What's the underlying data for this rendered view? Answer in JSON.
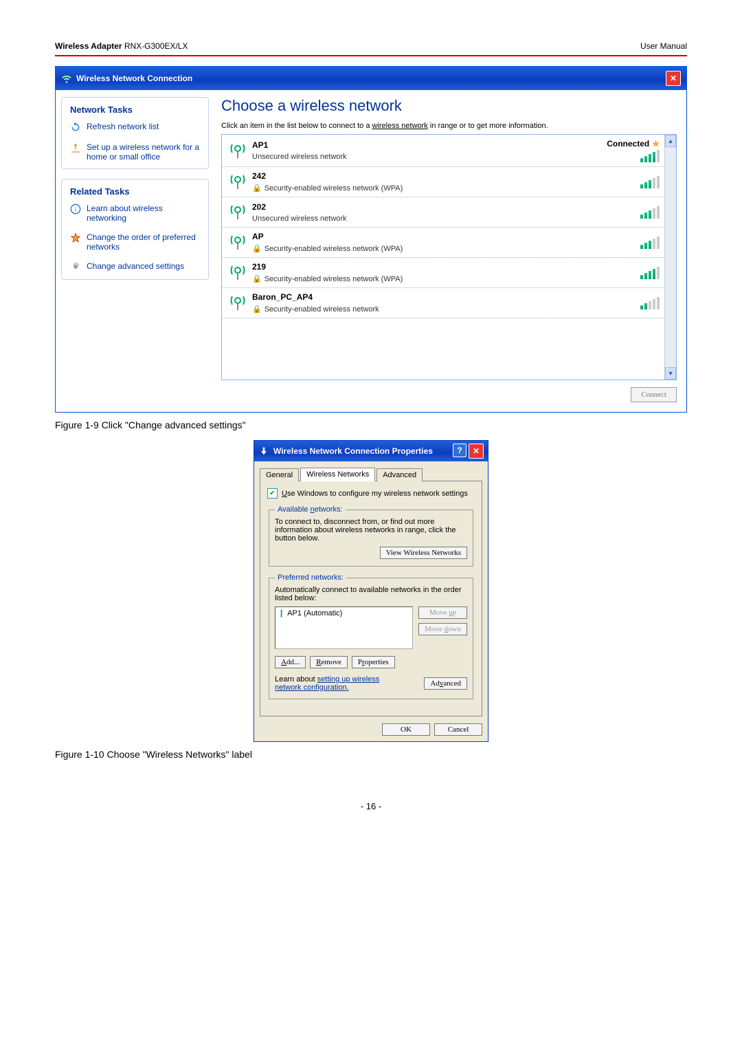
{
  "header": {
    "product_bold": "Wireless Adapter",
    "product_rest": " RNX-G300EX/LX",
    "right": "User Manual"
  },
  "win1": {
    "title": "Wireless Network Connection",
    "side": {
      "network_tasks_title": "Network Tasks",
      "refresh": "Refresh network list",
      "setup": "Set up a wireless network for a home or small office",
      "related_tasks_title": "Related Tasks",
      "learn": "Learn about wireless networking",
      "order": "Change the order of preferred networks",
      "advanced": "Change advanced settings"
    },
    "main": {
      "heading": "Choose a wireless network",
      "hint_pre": "Click an item in the list below to connect to a ",
      "hint_link": "wireless network",
      "hint_post": " in range or to get more information.",
      "connect_btn": "Connect",
      "connected_label": "Connected",
      "items": [
        {
          "name": "AP1",
          "sec": "Unsecured wireless network",
          "lock": false,
          "connected": true,
          "sig": 4
        },
        {
          "name": "242",
          "sec": "Security-enabled wireless network (WPA)",
          "lock": true,
          "connected": false,
          "sig": 3
        },
        {
          "name": "202",
          "sec": "Unsecured wireless network",
          "lock": false,
          "connected": false,
          "sig": 3
        },
        {
          "name": "AP",
          "sec": "Security-enabled wireless network (WPA)",
          "lock": true,
          "connected": false,
          "sig": 3
        },
        {
          "name": "219",
          "sec": "Security-enabled wireless network (WPA)",
          "lock": true,
          "connected": false,
          "sig": 4
        },
        {
          "name": "Baron_PC_AP4",
          "sec": "Security-enabled wireless network",
          "lock": true,
          "connected": false,
          "sig": 2
        }
      ]
    }
  },
  "caption1": "Figure 1-9 Click \"Change advanced settings\"",
  "win2": {
    "title": "Wireless Network Connection Properties",
    "tabs": {
      "general": "General",
      "wireless": "Wireless Networks",
      "advanced": "Advanced"
    },
    "use_windows": "Use Windows to configure my wireless network settings",
    "available_legend": "Available networks:",
    "available_text": "To connect to, disconnect from, or find out more information about wireless networks in range, click the button below.",
    "view_btn": "View Wireless Networks",
    "preferred_legend": "Preferred networks:",
    "preferred_text": "Automatically connect to available networks in the order listed below:",
    "pref_item": "AP1 (Automatic)",
    "moveup": "Move up",
    "movedown": "Move down",
    "add": "Add...",
    "remove": "Remove",
    "properties": "Properties",
    "learn_text": "Learn about ",
    "learn_link": "setting up wireless network configuration.",
    "adv_btn": "Advanced",
    "ok": "OK",
    "cancel": "Cancel"
  },
  "caption2": "Figure 1-10 Choose \"Wireless Networks\" label",
  "page_number": "- 16 -"
}
